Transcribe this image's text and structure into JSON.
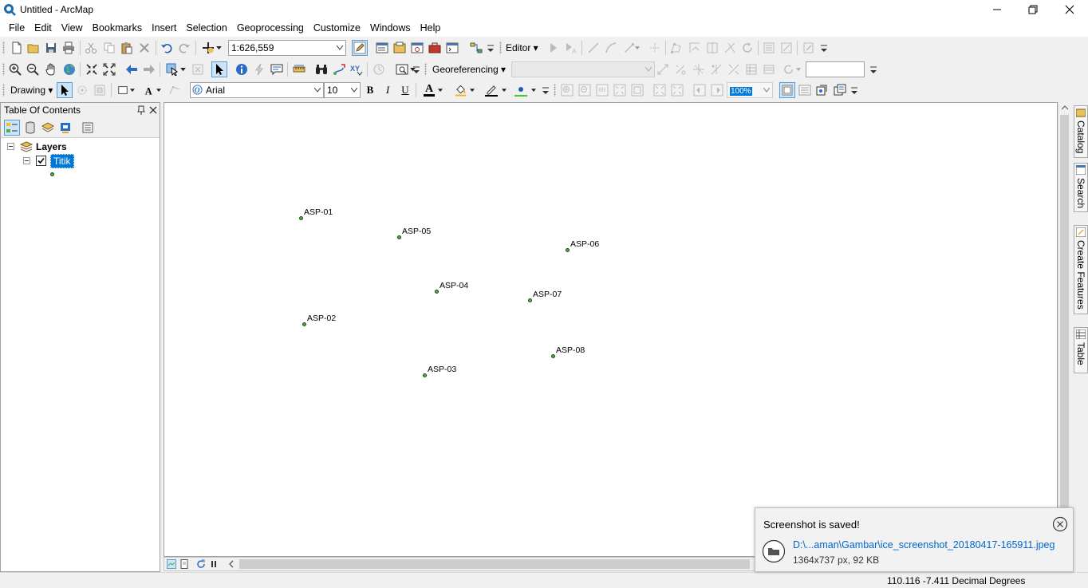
{
  "window": {
    "title": "Untitled - ArcMap"
  },
  "menu": [
    "File",
    "Edit",
    "View",
    "Bookmarks",
    "Insert",
    "Selection",
    "Geoprocessing",
    "Customize",
    "Windows",
    "Help"
  ],
  "standard_toolbar": {
    "scale": "1:626,559",
    "editor_label": "Editor ▾"
  },
  "tools_toolbar": {
    "georeferencing_label": "Georeferencing ▾",
    "layer_combo": "",
    "input_box": ""
  },
  "draw_toolbar": {
    "drawing_label": "Drawing ▾",
    "font": "Arial",
    "size": "10",
    "bold": "B",
    "italic": "I",
    "underline": "U",
    "font_color_glyph": "A",
    "zoom_box": "100%"
  },
  "toc": {
    "title": "Table Of Contents",
    "layers_label": "Layers",
    "layer_name": "Titik"
  },
  "map_points": [
    {
      "label": "ASP-01"
    },
    {
      "label": "ASP-05"
    },
    {
      "label": "ASP-06"
    },
    {
      "label": "ASP-04"
    },
    {
      "label": "ASP-07"
    },
    {
      "label": "ASP-02"
    },
    {
      "label": "ASP-08"
    },
    {
      "label": "ASP-03"
    }
  ],
  "right_dock": [
    "Catalog",
    "Search",
    "Create Features",
    "Table"
  ],
  "status": {
    "coords": "110.116  -7.411 Decimal Degrees"
  },
  "toast": {
    "title": "Screenshot is saved!",
    "path": "D:\\...aman\\Gambar\\ice_screenshot_20180417-165911.jpeg",
    "info": "1364x737 px, 92 KB"
  },
  "colors": {
    "point_fill": "#5aa84a",
    "selection": "#0078d7",
    "link": "#0066cc"
  }
}
